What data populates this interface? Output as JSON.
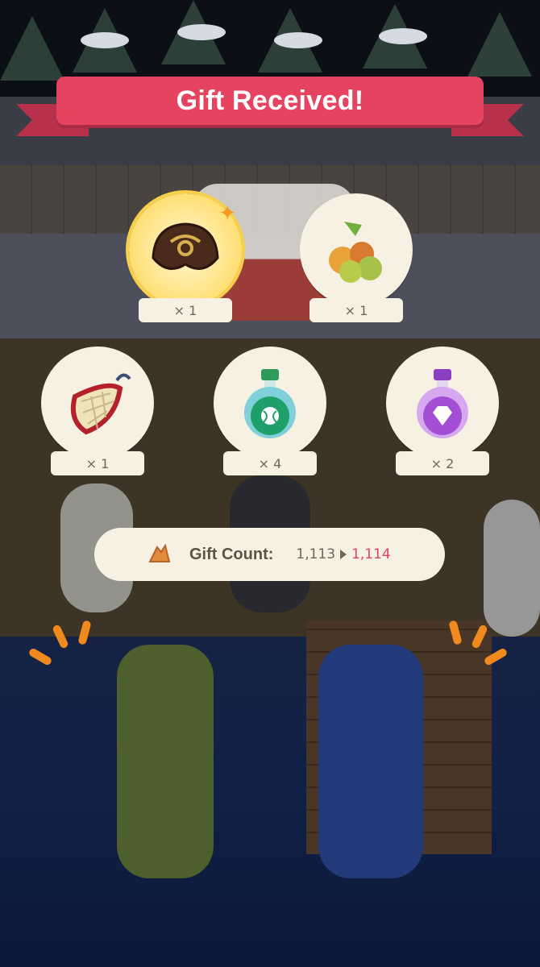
{
  "banner": {
    "title": "Gift Received!"
  },
  "items": [
    {
      "name": "fortune-cookie",
      "quantity": "× 1",
      "highlight": true
    },
    {
      "name": "fruit",
      "quantity": "× 1",
      "highlight": false
    },
    {
      "name": "net",
      "quantity": "× 1",
      "highlight": false
    },
    {
      "name": "green-essence",
      "quantity": "× 4",
      "highlight": false
    },
    {
      "name": "purple-essence",
      "quantity": "× 2",
      "highlight": false
    }
  ],
  "gift_count": {
    "label": "Gift Count:",
    "old_value": "1,113",
    "new_value": "1,114"
  },
  "colors": {
    "banner": "#e5435f",
    "panel": "#f6f1e2",
    "new_count": "#e0435f",
    "accent": "#f08a1f"
  }
}
